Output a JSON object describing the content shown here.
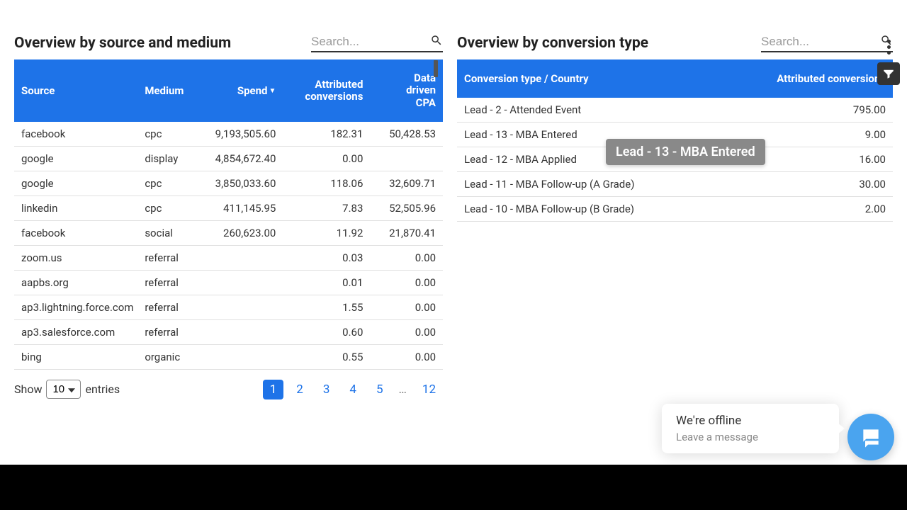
{
  "left_panel": {
    "title": "Overview by source and medium",
    "search_placeholder": "Search...",
    "columns": {
      "source": "Source",
      "medium": "Medium",
      "spend": "Spend",
      "attributed_line1": "Attributed",
      "attributed_line2": "conversions",
      "cpa_line1": "Data",
      "cpa_line2": "driven",
      "cpa_line3": "CPA"
    },
    "rows": [
      {
        "source": "facebook",
        "medium": "cpc",
        "spend": "9,193,505.60",
        "attr": "182.31",
        "cpa": "50,428.53"
      },
      {
        "source": "google",
        "medium": "display",
        "spend": "4,854,672.40",
        "attr": "0.00",
        "cpa": ""
      },
      {
        "source": "google",
        "medium": "cpc",
        "spend": "3,850,033.60",
        "attr": "118.06",
        "cpa": "32,609.71"
      },
      {
        "source": "linkedin",
        "medium": "cpc",
        "spend": "411,145.95",
        "attr": "7.83",
        "cpa": "52,505.96"
      },
      {
        "source": "facebook",
        "medium": "social",
        "spend": "260,623.00",
        "attr": "11.92",
        "cpa": "21,870.41"
      },
      {
        "source": "zoom.us",
        "medium": "referral",
        "spend": "",
        "attr": "0.03",
        "cpa": "0.00"
      },
      {
        "source": "aapbs.org",
        "medium": "referral",
        "spend": "",
        "attr": "0.01",
        "cpa": "0.00"
      },
      {
        "source": "ap3.lightning.force.com",
        "medium": "referral",
        "spend": "",
        "attr": "1.55",
        "cpa": "0.00"
      },
      {
        "source": "ap3.salesforce.com",
        "medium": "referral",
        "spend": "",
        "attr": "0.60",
        "cpa": "0.00"
      },
      {
        "source": "bing",
        "medium": "organic",
        "spend": "",
        "attr": "0.55",
        "cpa": "0.00"
      }
    ],
    "footer": {
      "show_label": "Show",
      "entries_label": "entries",
      "entries_value": "10",
      "pages": [
        "1",
        "2",
        "3",
        "4",
        "5",
        "12"
      ],
      "ellipsis": "…"
    }
  },
  "right_panel": {
    "title": "Overview by conversion type",
    "search_placeholder": "Search...",
    "columns": {
      "conv_type": "Conversion type / Country",
      "attr_conv": "Attributed conversions"
    },
    "rows": [
      {
        "type": "Lead - 2 - Attended Event",
        "value": "795.00"
      },
      {
        "type": "Lead - 13 - MBA Entered",
        "value": "9.00"
      },
      {
        "type": "Lead - 12 - MBA Applied",
        "value": "16.00"
      },
      {
        "type": "Lead - 11 - MBA Follow-up (A Grade)",
        "value": "30.00"
      },
      {
        "type": "Lead - 10 - MBA Follow-up (B Grade)",
        "value": "2.00"
      }
    ]
  },
  "tooltip": "Lead - 13 - MBA Entered",
  "chat": {
    "title": "We're offline",
    "subtitle": "Leave a message"
  }
}
